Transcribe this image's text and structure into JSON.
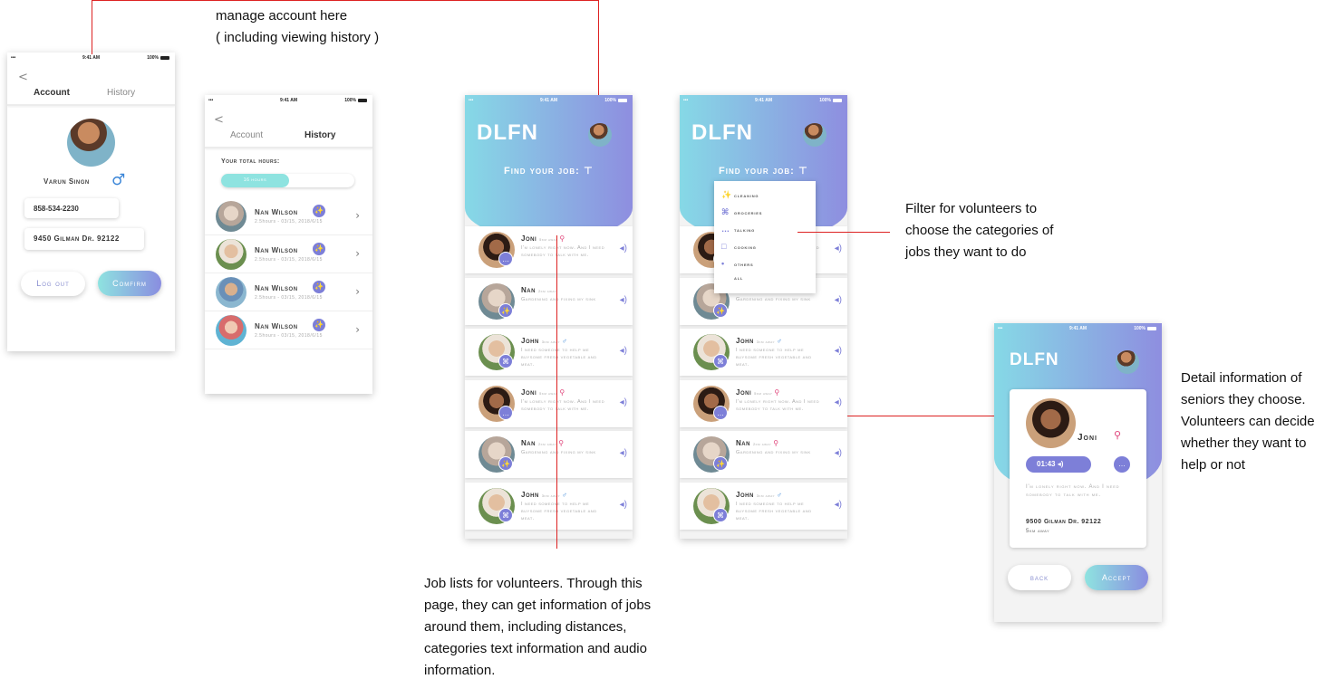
{
  "annotations": {
    "account": [
      "manage account here",
      "( including viewing history )"
    ],
    "filter": [
      "Filter for volunteers to",
      "choose the categories of",
      "jobs they want to do"
    ],
    "detail": [
      "Detail information of",
      "seniors they choose.",
      "Volunteers can decide",
      "whether they want to",
      "help or not"
    ],
    "joblist": [
      "Job lists for volunteers. Through this",
      "page, they can get information of jobs",
      "around them, including distances,",
      "categories text information and audio",
      "information."
    ]
  },
  "statusbar": {
    "time": "9:41 AM",
    "battery": "100%",
    "left": "••• ◠"
  },
  "account_screen": {
    "back": "<",
    "tab_account": "Account",
    "tab_history": "History",
    "name": "Varun Singn",
    "gender_icon": "♂",
    "phone": "858-534-2230",
    "address": "9450 Gilman Dr. 92122",
    "logout": "Log out",
    "confirm": "Comfirm"
  },
  "history_screen": {
    "back": "<",
    "tab_account": "Account",
    "tab_history": "History",
    "total_label": "Your total hours:",
    "total_value": "16 hours",
    "rows": [
      {
        "name": "Nan Wilson",
        "meta": "2.5hours - 03/15, 2018/6/15",
        "icon": "✨"
      },
      {
        "name": "Nan Wilson",
        "meta": "2.5hours - 03/15, 2018/6/15",
        "icon": "✨"
      },
      {
        "name": "Nan Wilson",
        "meta": "2.5hours - 03/15, 2018/6/15",
        "icon": "✨"
      },
      {
        "name": "Nan Wilson",
        "meta": "2.5hours - 03/15, 2018/6/15",
        "icon": "✨"
      }
    ]
  },
  "app": {
    "logo": "DLFN",
    "find_job": "Find your job:",
    "filter_icon": "⊤"
  },
  "jobs": [
    {
      "name": "Joni",
      "dist": "5km away",
      "icon": "⚲",
      "icon_color": "#e0457b",
      "text": "I'm lonely right now. And I need somebody to talk with me.",
      "badge": "…"
    },
    {
      "name": "Nan",
      "dist": "2km away",
      "icon": "",
      "icon_color": "#e0457b",
      "text": "Gardening and fixing my sink",
      "badge": "✨"
    },
    {
      "name": "John",
      "dist": "3km away",
      "icon": "♂",
      "icon_color": "#3b86d8",
      "text": "I need someone to help me buysome fresh vegetable and meat.",
      "badge": "⌘"
    },
    {
      "name": "Joni",
      "dist": "5km away",
      "icon": "⚲",
      "icon_color": "#e0457b",
      "text": "I'm lonely right now. And I need somebody to talk with me.",
      "badge": "…"
    },
    {
      "name": "Nan",
      "dist": "2km away",
      "icon": "⚲",
      "icon_color": "#e0457b",
      "text": "Gardening and fixing my sink",
      "badge": "✨"
    },
    {
      "name": "John",
      "dist": "3km away",
      "icon": "♂",
      "icon_color": "#3b86d8",
      "text": "I need someone to help me buysome fresh vegetable and meat.",
      "badge": "⌘"
    }
  ],
  "speaker_icon": "◂)",
  "filter_menu": [
    {
      "label": "cleaning",
      "icon": "✨"
    },
    {
      "label": "groceries",
      "icon": "⌘"
    },
    {
      "label": "talking",
      "icon": "…"
    },
    {
      "label": "cooking",
      "icon": "□"
    },
    {
      "label": "others",
      "icon": "•"
    },
    {
      "label": "all",
      "icon": ""
    }
  ],
  "detail_screen": {
    "name": "Joni",
    "name_icon": "⚲",
    "audio_time": "01:43",
    "text": "I'm lonely right now. And I need somebody to talk with me.",
    "address": "9500 Gilman Dr. 92122",
    "distance": "5km away",
    "back": "back",
    "accept": "Accept"
  },
  "colors": {
    "accent": "#7d7fd8",
    "teal": "#86d9e6",
    "annotation_line": "#d22222"
  }
}
